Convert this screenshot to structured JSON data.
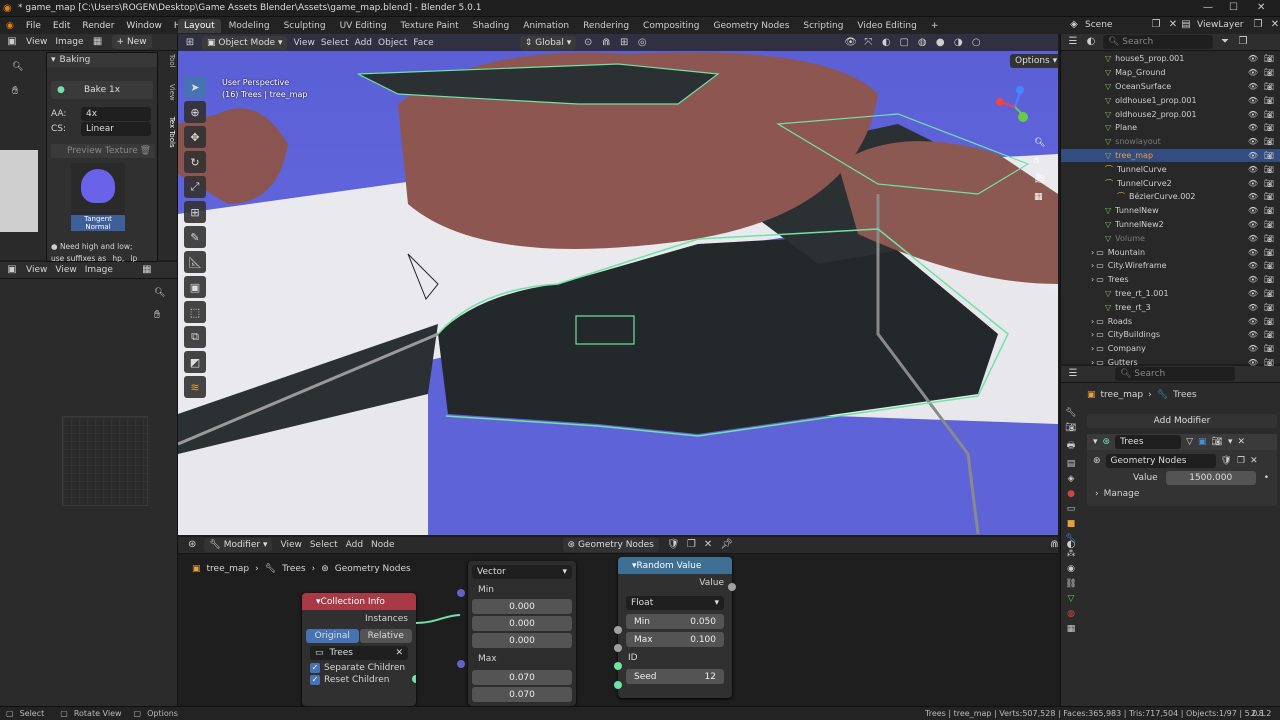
{
  "window": {
    "title": "* game_map [C:\\Users\\ROGEN\\Desktop\\Game Assets Blender\\Assets\\game_map.blend] - Blender 5.0.1"
  },
  "menus": [
    "File",
    "Edit",
    "Render",
    "Window",
    "Help"
  ],
  "workspaces": [
    "Layout",
    "Modeling",
    "Sculpting",
    "UV Editing",
    "Texture Paint",
    "Shading",
    "Animation",
    "Rendering",
    "Compositing",
    "Geometry Nodes",
    "Scripting",
    "Video Editing"
  ],
  "active_workspace": "Layout",
  "scene": {
    "label": "Scene",
    "view_layer": "ViewLayer"
  },
  "image_editor_top": {
    "menus": [
      "View",
      "Image"
    ],
    "new_label": "New",
    "panel_title": "Baking",
    "bake_label": "Bake 1x",
    "aa_label": "AA:",
    "aa_value": "4x",
    "cs_label": "CS:",
    "cs_value": "Linear",
    "preview_label": "Preview Texture",
    "texture_caption": "Tangent Normal",
    "hint_line1": "Need high and low;",
    "hint_line2": "use suffixes as _hp, _lp",
    "side_tabs": [
      "Tool",
      "View",
      "Tex Tools"
    ]
  },
  "image_editor_bottom": {
    "menus": [
      "View",
      "View",
      "Image"
    ]
  },
  "viewport": {
    "mode": "Object Mode",
    "menus": [
      "View",
      "Select",
      "Add",
      "Object",
      "Face"
    ],
    "orientation": "Global",
    "options_label": "Options",
    "overlay_line1": "User Perspective",
    "overlay_line2": "(16) Trees | tree_map"
  },
  "outliner": {
    "search_placeholder": "Search",
    "items": [
      {
        "name": "house5_prop.001",
        "indent": 1,
        "selected": false,
        "dim": false,
        "icon": "mesh"
      },
      {
        "name": "Map_Ground",
        "indent": 1,
        "selected": false,
        "dim": false,
        "icon": "mesh"
      },
      {
        "name": "OceanSurface",
        "indent": 1,
        "selected": false,
        "dim": false,
        "icon": "mesh"
      },
      {
        "name": "oldhouse1_prop.001",
        "indent": 1,
        "selected": false,
        "dim": false,
        "icon": "mesh"
      },
      {
        "name": "oldhouse2_prop.001",
        "indent": 1,
        "selected": false,
        "dim": false,
        "icon": "mesh"
      },
      {
        "name": "Plane",
        "indent": 1,
        "selected": false,
        "dim": false,
        "icon": "mesh"
      },
      {
        "name": "snowlayout",
        "indent": 1,
        "selected": false,
        "dim": true,
        "icon": "mesh"
      },
      {
        "name": "tree_map",
        "indent": 1,
        "selected": true,
        "dim": false,
        "icon": "mesh"
      },
      {
        "name": "TunnelCurve",
        "indent": 1,
        "selected": false,
        "dim": false,
        "icon": "curve"
      },
      {
        "name": "TunnelCurve2",
        "indent": 1,
        "selected": false,
        "dim": false,
        "icon": "curve"
      },
      {
        "name": "BézierCurve.002",
        "indent": 2,
        "selected": false,
        "dim": false,
        "icon": "curve"
      },
      {
        "name": "TunnelNew",
        "indent": 1,
        "selected": false,
        "dim": false,
        "icon": "mesh"
      },
      {
        "name": "TunnelNew2",
        "indent": 1,
        "selected": false,
        "dim": false,
        "icon": "mesh"
      },
      {
        "name": "Volume",
        "indent": 1,
        "selected": false,
        "dim": true,
        "icon": "mesh"
      },
      {
        "name": "Mountain",
        "indent": 0,
        "selected": false,
        "dim": false,
        "icon": "collection"
      },
      {
        "name": "City.Wireframe",
        "indent": 0,
        "selected": false,
        "dim": false,
        "icon": "collection"
      },
      {
        "name": "Trees",
        "indent": 0,
        "selected": false,
        "dim": false,
        "icon": "collection"
      },
      {
        "name": "tree_rt_1.001",
        "indent": 1,
        "selected": false,
        "dim": false,
        "icon": "mesh"
      },
      {
        "name": "tree_rt_3",
        "indent": 1,
        "selected": false,
        "dim": false,
        "icon": "mesh"
      },
      {
        "name": "Roads",
        "indent": 0,
        "selected": false,
        "dim": false,
        "icon": "collection"
      },
      {
        "name": "CityBuildings",
        "indent": 0,
        "selected": false,
        "dim": false,
        "icon": "collection"
      },
      {
        "name": "Company",
        "indent": 0,
        "selected": false,
        "dim": false,
        "icon": "collection"
      },
      {
        "name": "Gutters",
        "indent": 0,
        "selected": false,
        "dim": false,
        "icon": "collection"
      }
    ]
  },
  "properties": {
    "search_placeholder": "Search",
    "breadcrumb_object": "tree_map",
    "breadcrumb_modifier": "Trees",
    "add_modifier_label": "Add Modifier",
    "modifier_name": "Trees",
    "node_group": "Geometry Nodes",
    "value_label": "Value",
    "value": "1500.000",
    "manage_label": "Manage"
  },
  "node_editor": {
    "editor_menu": "Modifier",
    "menus": [
      "View",
      "Select",
      "Add",
      "Node"
    ],
    "tree_name": "Geometry Nodes",
    "breadcrumb": [
      "tree_map",
      "Trees",
      "Geometry Nodes"
    ],
    "collection_info": {
      "title": "Collection Info",
      "output": "Instances",
      "btn_original": "Original",
      "btn_relative": "Relative",
      "collection": "Trees",
      "opt1": "Separate Children",
      "opt2": "Reset Children"
    },
    "vector_node": {
      "type": "Vector",
      "min_label": "Min",
      "min_values": [
        "0.000",
        "0.000",
        "0.000"
      ],
      "max_label": "Max",
      "max_values": [
        "0.070",
        "0.070"
      ]
    },
    "random_value": {
      "title": "Random Value",
      "output": "Value",
      "type": "Float",
      "min_label": "Min",
      "min_value": "0.050",
      "max_label": "Max",
      "max_value": "0.100",
      "id_label": "ID",
      "seed_label": "Seed",
      "seed_value": "12"
    }
  },
  "statusbar": {
    "select": "Select",
    "rotate": "Rotate View",
    "options": "Options",
    "stats": "Trees | tree_map | Verts:507,528 | Faces:365,983 | Tris:717,504 | Objects:1/97 | 5.0.1",
    "version": "2.8.2"
  },
  "colors": {
    "accent": "#4772b3",
    "selection_outline": "#6fe3a5",
    "node_collection": "#a83a46",
    "node_random": "#3e6f95"
  }
}
